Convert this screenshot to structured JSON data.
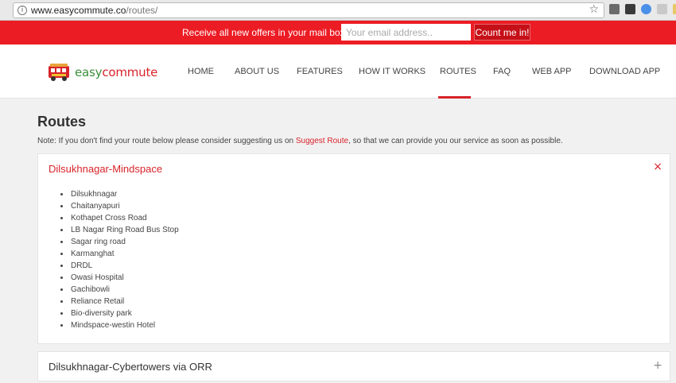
{
  "browser": {
    "url_host": "www.easycommute.co",
    "url_path": "/routes/"
  },
  "offer": {
    "text": "Receive all new offers in your mail box!",
    "email_placeholder": "Your email address..",
    "button_label": "Count me in!"
  },
  "brand": {
    "easy": "easy",
    "commute": "commute"
  },
  "nav": {
    "items": [
      "HOME",
      "ABOUT US",
      "FEATURES",
      "HOW IT WORKS",
      "ROUTES",
      "FAQ",
      "WEB APP",
      "DOWNLOAD APP"
    ],
    "active": "ROUTES"
  },
  "main": {
    "title": "Routes",
    "note_prefix": "Note: If you don't find your route below please consider suggesting us on ",
    "note_link": "Suggest Route",
    "note_suffix": ", so that we can provide you our service as soon as possible."
  },
  "routes": [
    {
      "name": "Dilsukhnagar-Mindspace",
      "expanded": true,
      "toggle": "×",
      "stops": [
        "Dilsukhnagar",
        "Chaitanyapuri",
        "Kothapet Cross Road",
        "LB Nagar Ring Road Bus Stop",
        "Sagar ring road",
        "Karmanghat",
        "DRDL",
        "Owasi Hospital",
        "Gachibowli",
        "Reliance Retail",
        "Bio-diversity park",
        "Mindspace-westin Hotel"
      ]
    },
    {
      "name": "Dilsukhnagar-Cybertowers via ORR",
      "expanded": false,
      "toggle": "+"
    }
  ],
  "colors": {
    "brand_red": "#d8232a",
    "offer_bar": "#ec1c24",
    "brand_green": "#3b8f3b"
  }
}
